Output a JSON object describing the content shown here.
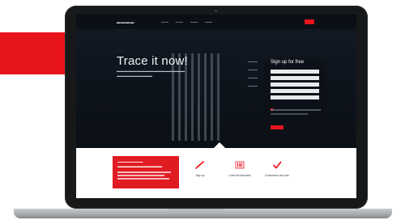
{
  "hero": {
    "title": "Trace it now!"
  },
  "signup": {
    "title": "Sign up for free"
  },
  "steps": [
    {
      "label": "Sign up",
      "icon": "pencil-icon"
    },
    {
      "label": "Code the barcodes",
      "icon": "barcode-icon"
    },
    {
      "label": "Consumers can scan",
      "icon": "checkmark-icon"
    }
  ],
  "colors": {
    "accent": "#e8141b",
    "hero_bg": "#0f151e"
  }
}
